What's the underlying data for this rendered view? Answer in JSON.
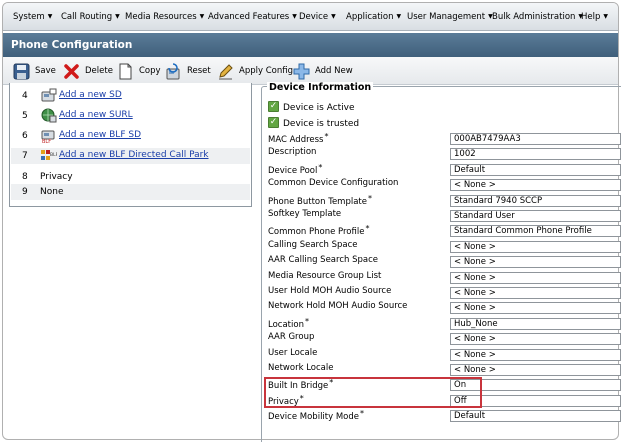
{
  "menu": [
    "System",
    "Call Routing",
    "Media Resources",
    "Advanced Features",
    "Device",
    "Application",
    "User Management",
    "Bulk Administration",
    "Help"
  ],
  "page_title": "Phone Configuration",
  "toolbar": {
    "save": "Save",
    "delete": "Delete",
    "copy": "Copy",
    "reset": "Reset",
    "apply_config": "Apply Config",
    "add_new": "Add New"
  },
  "left_list": [
    {
      "num": "4",
      "label": "Add a new SD",
      "icon": "sd-icon"
    },
    {
      "num": "5",
      "label": "Add a new SURL",
      "icon": "surl-icon"
    },
    {
      "num": "6",
      "label": "Add a new BLF SD",
      "icon": "blf-sd-icon"
    },
    {
      "num": "7",
      "label": "Add a new BLF Directed Call Park",
      "icon": "blf-call-park-icon"
    },
    {
      "num": "8",
      "label": "Privacy"
    },
    {
      "num": "9",
      "label": "None"
    }
  ],
  "device_info": {
    "legend": "Device Information",
    "checkboxes": [
      {
        "label": "Device is Active",
        "checked": true
      },
      {
        "label": "Device is trusted",
        "checked": true
      }
    ],
    "fields": [
      {
        "label": "MAC Address",
        "required": true,
        "value": "000AB7479AA3"
      },
      {
        "label": "Description",
        "required": false,
        "value": "1002"
      },
      {
        "label": "Device Pool",
        "required": true,
        "value": "Default"
      },
      {
        "label": "Common Device Configuration",
        "required": false,
        "value": "< None >"
      },
      {
        "label": "Phone Button Template",
        "required": true,
        "value": "Standard 7940 SCCP"
      },
      {
        "label": "Softkey Template",
        "required": false,
        "value": "Standard User"
      },
      {
        "label": "Common Phone Profile",
        "required": true,
        "value": "Standard Common Phone Profile"
      },
      {
        "label": "Calling Search Space",
        "required": false,
        "value": "< None >"
      },
      {
        "label": "AAR Calling Search Space",
        "required": false,
        "value": "< None >"
      },
      {
        "label": "Media Resource Group List",
        "required": false,
        "value": "< None >"
      },
      {
        "label": "User Hold MOH Audio Source",
        "required": false,
        "value": "< None >"
      },
      {
        "label": "Network Hold MOH Audio Source",
        "required": false,
        "value": "< None >"
      },
      {
        "label": "Location",
        "required": true,
        "value": "Hub_None"
      },
      {
        "label": "AAR Group",
        "required": false,
        "value": "< None >"
      },
      {
        "label": "User Locale",
        "required": false,
        "value": "< None >"
      },
      {
        "label": "Network Locale",
        "required": false,
        "value": "< None >"
      },
      {
        "label": "Built In Bridge",
        "required": true,
        "value": "On"
      },
      {
        "label": "Privacy",
        "required": true,
        "value": "Off"
      },
      {
        "label": "Device Mobility Mode",
        "required": true,
        "value": "Default"
      }
    ]
  },
  "highlight_color": "#c8343c",
  "title_bar_color": "#4a6b87"
}
